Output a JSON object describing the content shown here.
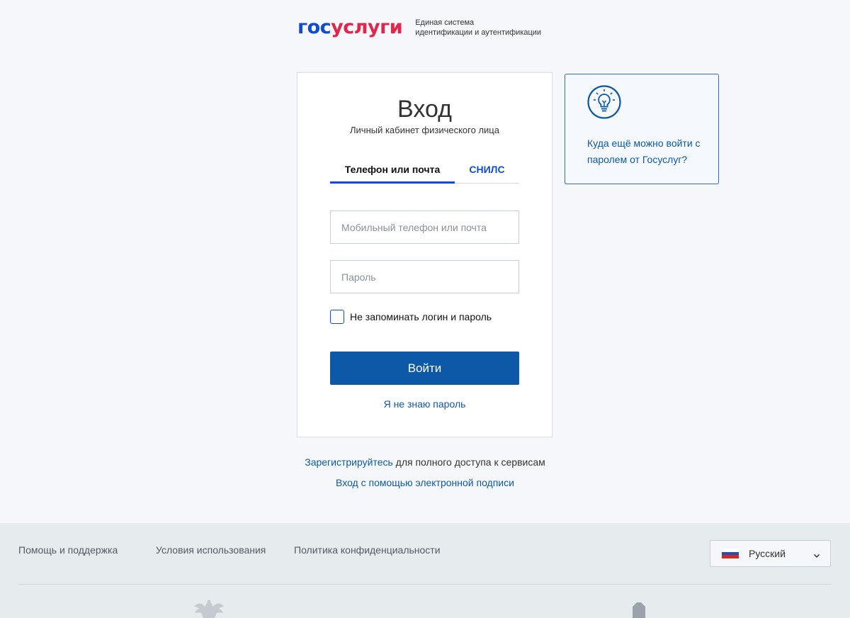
{
  "header": {
    "logo_part1": "гос",
    "logo_part2": "услуги",
    "subtitle_line1": "Единая система",
    "subtitle_line2": "идентификации и аутентификации"
  },
  "login": {
    "title": "Вход",
    "subtitle": "Личный кабинет физического лица",
    "tabs": [
      {
        "label": "Телефон или почта",
        "active": true
      },
      {
        "label": "СНИЛС",
        "active": false
      }
    ],
    "login_placeholder": "Мобильный телефон или почта",
    "password_placeholder": "Пароль",
    "remember_label": "Не запоминать логин и пароль",
    "remember_checked": false,
    "submit_label": "Войти",
    "forgot_label": "Я не знаю пароль"
  },
  "info": {
    "icon": "lightbulb-icon",
    "text": "Куда ещё можно войти с паролем от Госуслуг?"
  },
  "links": {
    "register_link": "Зарегистрируйтесь",
    "register_rest": " для полного доступа к сервисам",
    "esign": "Вход с помощью электронной подписи"
  },
  "footer": {
    "links": [
      "Помощь и поддержка",
      "Условия использования",
      "Политика конфиденциальности"
    ],
    "language": {
      "label": "Русский",
      "flag": "russia-flag-icon",
      "flag_colors": [
        "#ffffff",
        "#1f4fbf",
        "#d52b1e"
      ]
    }
  },
  "colors": {
    "accent": "#0d59a8",
    "brand_blue": "#0d4cd3",
    "brand_red": "#e4244b",
    "background": "#f5f7fa",
    "footer_bg": "#e6ebee"
  }
}
